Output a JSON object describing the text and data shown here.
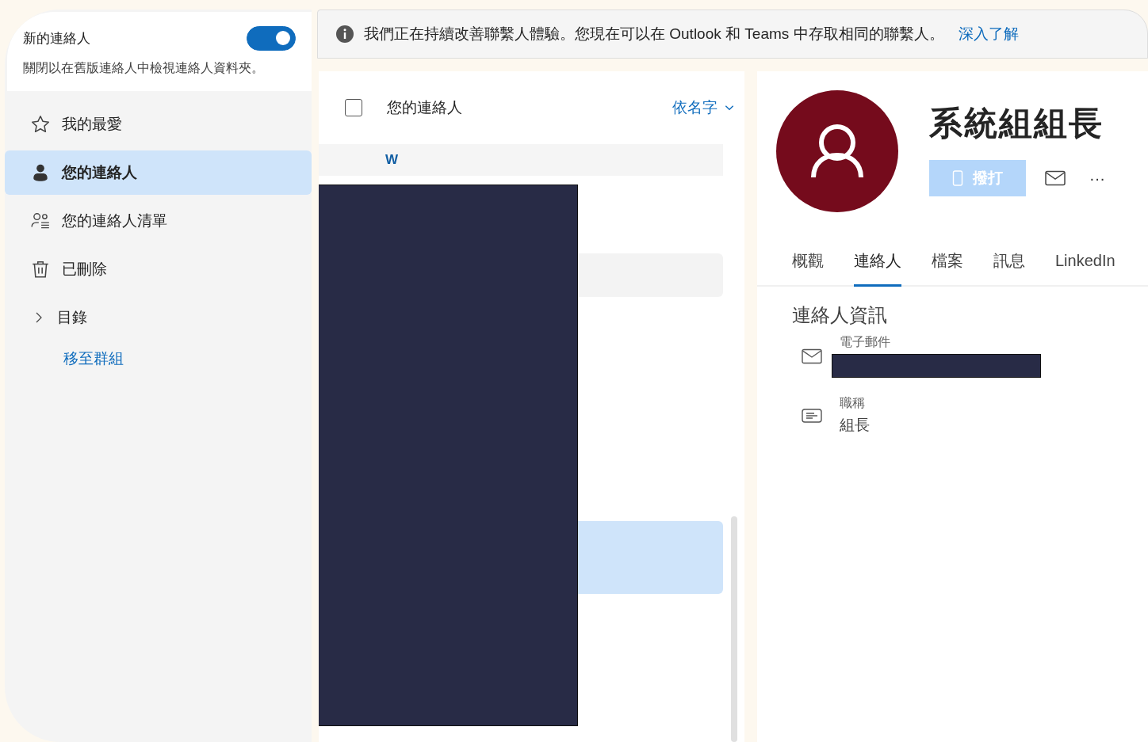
{
  "sidebar": {
    "new_contacts": {
      "title": "新的連絡人",
      "on": true,
      "description": "關閉以在舊版連絡人中檢視連絡人資料夾。"
    },
    "items": [
      {
        "kind": "favorites",
        "label": "我的最愛",
        "selected": false
      },
      {
        "kind": "contacts",
        "label": "您的連絡人",
        "selected": true
      },
      {
        "kind": "lists",
        "label": "您的連絡人清單",
        "selected": false
      },
      {
        "kind": "deleted",
        "label": "已刪除",
        "selected": false
      },
      {
        "kind": "directory",
        "label": "目錄",
        "selected": false,
        "expanded": false
      }
    ],
    "link": "移至群組"
  },
  "banner": {
    "text": "我們正在持續改善聯繫人體驗。您現在可以在 Outlook 和 Teams 中存取相同的聯繫人。",
    "link": "深入了解"
  },
  "list": {
    "title": "您的連絡人",
    "checked": false,
    "sort": "依名字",
    "section": "W",
    "rows": [
      {
        "selected": false
      },
      {
        "selected": true
      }
    ]
  },
  "details": {
    "name": "系統組組長",
    "call": "撥打",
    "more": "···",
    "tabs": [
      {
        "label": "概觀",
        "selected": false
      },
      {
        "label": "連絡人",
        "selected": true
      },
      {
        "label": "檔案",
        "selected": false
      },
      {
        "label": "訊息",
        "selected": false
      },
      {
        "label": "LinkedIn",
        "selected": false
      }
    ],
    "section": "連絡人資訊",
    "fields": [
      {
        "kind": "email",
        "label": "電子郵件"
      },
      {
        "kind": "title",
        "label": "職稱",
        "value": "組長"
      }
    ]
  }
}
